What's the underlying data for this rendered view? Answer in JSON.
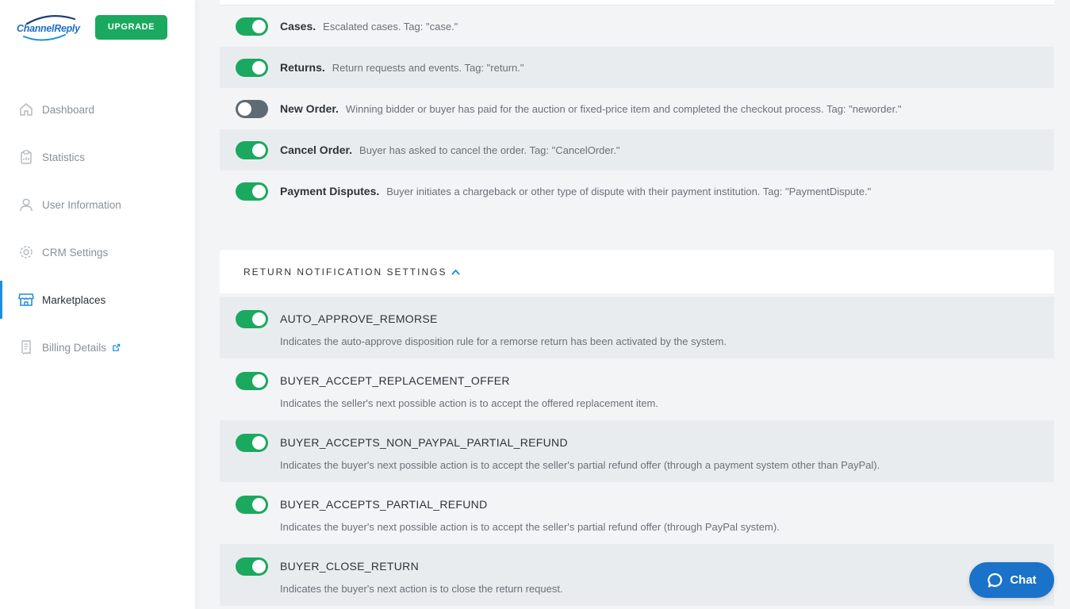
{
  "brand": {
    "logo_text": "ChannelReply",
    "upgrade_label": "UPGRADE",
    "accent": "#1aa95f",
    "link_blue": "#1d8fe0"
  },
  "sidebar": {
    "items": [
      {
        "label": "Dashboard",
        "icon": "home-icon"
      },
      {
        "label": "Statistics",
        "icon": "clipboard-icon"
      },
      {
        "label": "User Information",
        "icon": "user-icon"
      },
      {
        "label": "CRM Settings",
        "icon": "gear-icon"
      },
      {
        "label": "Marketplaces",
        "icon": "store-icon"
      },
      {
        "label": "Billing Details",
        "icon": "receipt-icon"
      }
    ],
    "active_item": "Marketplaces"
  },
  "notifications": [
    {
      "title": "Cases.",
      "desc": "Escalated cases. Tag: \"case.\"",
      "enabled": true
    },
    {
      "title": "Returns.",
      "desc": "Return requests and events. Tag: \"return.\"",
      "enabled": true
    },
    {
      "title": "New Order.",
      "desc": "Winning bidder or buyer has paid for the auction or fixed-price item and completed the checkout process. Tag: \"neworder.\"",
      "enabled": false
    },
    {
      "title": "Cancel Order.",
      "desc": "Buyer has asked to cancel the order. Tag: \"CancelOrder.\"",
      "enabled": true
    },
    {
      "title": "Payment Disputes.",
      "desc": "Buyer initiates a chargeback or other type of dispute with their payment institution. Tag: \"PaymentDispute.\"",
      "enabled": true
    }
  ],
  "return_section": {
    "title": "RETURN NOTIFICATION SETTINGS",
    "settings": [
      {
        "name": "AUTO_APPROVE_REMORSE",
        "desc": "Indicates the auto-approve disposition rule for a remorse return has been activated by the system.",
        "enabled": true
      },
      {
        "name": "BUYER_ACCEPT_REPLACEMENT_OFFER",
        "desc": "Indicates the seller's next possible action is to accept the offered replacement item.",
        "enabled": true
      },
      {
        "name": "BUYER_ACCEPTS_NON_PAYPAL_PARTIAL_REFUND",
        "desc": "Indicates the buyer's next possible action is to accept the seller's partial refund offer (through a payment system other than PayPal).",
        "enabled": true
      },
      {
        "name": "BUYER_ACCEPTS_PARTIAL_REFUND",
        "desc": "Indicates the buyer's next possible action is to accept the seller's partial refund offer (through PayPal system).",
        "enabled": true
      },
      {
        "name": "BUYER_CLOSE_RETURN",
        "desc": "Indicates the buyer's next action is to close the return request.",
        "enabled": true
      }
    ]
  },
  "chat": {
    "label": "Chat",
    "color": "#1a73c9"
  }
}
